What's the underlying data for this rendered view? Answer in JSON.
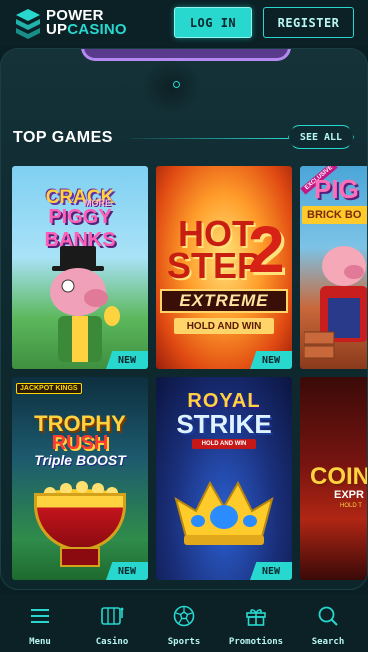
{
  "header": {
    "logo_line1": "POWER",
    "logo_line2_up": "UP",
    "logo_line2_casino": "CASINO",
    "login_label": "LOG IN",
    "register_label": "REGISTER"
  },
  "section": {
    "title": "TOP GAMES",
    "see_all_label": "SEE ALL"
  },
  "games": [
    {
      "title_line1": "CRACK",
      "title_more": "MORE",
      "title_line2": "PIGGY BANKS",
      "badge": "NEW"
    },
    {
      "title_line1": "HOT",
      "title_line2": "STEP",
      "title_number": "2",
      "subtitle": "EXTREME",
      "tagline": "HOLD AND WIN",
      "badge": "NEW"
    },
    {
      "title_line1": "PIG",
      "title_line2": "BRICK BO",
      "ribbon": "EXCLUSIVE"
    },
    {
      "brand": "JACKPOT KINGS",
      "title_line1": "TROPHY",
      "title_line2": "RUSH",
      "title_line3": "Triple BOOST",
      "badge": "NEW"
    },
    {
      "title_line1": "ROYAL",
      "title_line2": "STRIKE",
      "tagline": "HOLD AND WIN",
      "badge": "NEW"
    },
    {
      "title_line1": "COIN",
      "title_line2": "EXPR",
      "tagline": "HOLD T"
    }
  ],
  "bottom_nav": [
    {
      "label": "Menu",
      "icon": "menu-icon"
    },
    {
      "label": "Casino",
      "icon": "slot-machine-icon"
    },
    {
      "label": "Sports",
      "icon": "football-icon"
    },
    {
      "label": "Promotions",
      "icon": "gift-icon"
    },
    {
      "label": "Search",
      "icon": "search-icon"
    }
  ],
  "colors": {
    "accent": "#28d8cf",
    "background": "#0a1f24",
    "panel": "#143238"
  }
}
